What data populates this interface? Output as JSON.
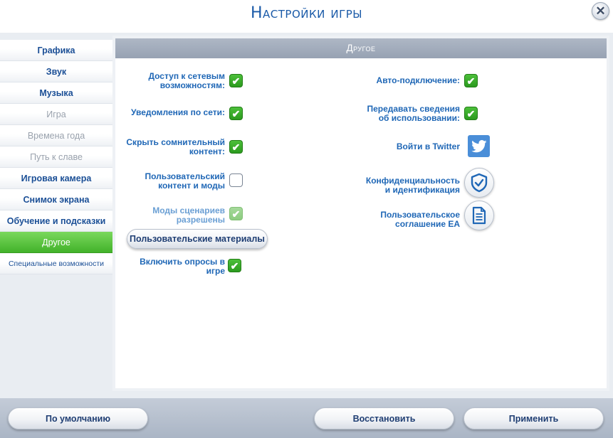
{
  "window": {
    "title": "Настройки игры",
    "close_glyph": "✕"
  },
  "sidebar": {
    "items": [
      {
        "label": "Графика",
        "state": "normal"
      },
      {
        "label": "Звук",
        "state": "normal"
      },
      {
        "label": "Музыка",
        "state": "normal"
      },
      {
        "label": "Игра",
        "state": "disabled"
      },
      {
        "label": "Времена года",
        "state": "disabled"
      },
      {
        "label": "Путь к славе",
        "state": "disabled"
      },
      {
        "label": "Игровая камера",
        "state": "normal"
      },
      {
        "label": "Снимок экрана",
        "state": "normal"
      },
      {
        "label": "Обучение и подсказки",
        "state": "normal"
      },
      {
        "label": "Другое",
        "state": "active"
      },
      {
        "label": "Специальные возможности",
        "state": "normal"
      }
    ]
  },
  "section": {
    "title": "Другое"
  },
  "left_options": [
    {
      "label": "Доступ к сетевым\nвозможностям:",
      "checked": true
    },
    {
      "label": "Уведомления по сети:",
      "checked": true
    },
    {
      "label": "Скрыть сомнительный\nконтент:",
      "checked": true
    },
    {
      "label": "Пользовательский\nконтент и моды",
      "checked": false
    },
    {
      "label": "Моды сценариев\nразрешены",
      "checked": true,
      "disabled": true
    },
    {
      "label": "Включить опросы в\nигре",
      "checked": true
    }
  ],
  "custom_materials_button": "Пользовательские материалы",
  "right_options": [
    {
      "label": "Авто-подключение:",
      "checked": true
    },
    {
      "label": "Передавать сведения\nоб использовании:",
      "checked": true
    }
  ],
  "links": {
    "twitter": "Войти в Twitter",
    "privacy": "Конфиденциальность\nи идентификация",
    "user_agreement": "Пользовательское\nсоглашение EA"
  },
  "footer": {
    "default_button": "По умолчанию",
    "restore_button": "Восстановить",
    "apply_button": "Применить"
  },
  "colors": {
    "title": "#1a5aa8",
    "label": "#1f67b6",
    "active_tab": "#42b22a",
    "check_green": "#2b9a1e",
    "twitter_blue": "#4a8ed8"
  },
  "check_glyph": "✔"
}
